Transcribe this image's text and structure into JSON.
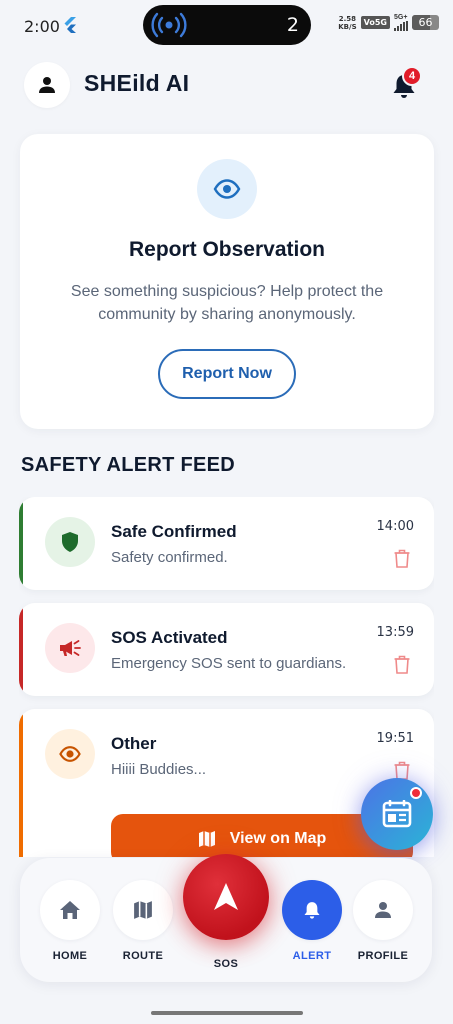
{
  "status_bar": {
    "time": "2:00",
    "live_count": "2",
    "speed_value": "2.58",
    "speed_unit": "KB/S",
    "volte": "Vo5G",
    "network": "5G+",
    "battery": "66"
  },
  "header": {
    "title": "SHEild AI",
    "notification_count": "4"
  },
  "report_card": {
    "title": "Report Observation",
    "description": "See something suspicious? Help protect the community by sharing anonymously.",
    "button_label": "Report Now"
  },
  "feed": {
    "section_title": "SAFETY ALERT FEED",
    "items": [
      {
        "title": "Safe Confirmed",
        "message": "Safety confirmed.",
        "time": "14:00",
        "accent": "#2e7d32",
        "icon": "shield-icon"
      },
      {
        "title": "SOS Activated",
        "message": "Emergency SOS sent to guardians.",
        "time": "13:59",
        "accent": "#c62828",
        "icon": "megaphone-icon"
      },
      {
        "title": "Other",
        "message": "Hiiii Buddies...",
        "time": "19:51",
        "accent": "#ef6c00",
        "icon": "eye-icon",
        "action_label": "View on Map"
      }
    ]
  },
  "nav": {
    "home": "HOME",
    "route": "ROUTE",
    "sos": "SOS",
    "alert": "ALERT",
    "profile": "PROFILE",
    "active": "ALERT"
  },
  "colors": {
    "primary_blue": "#2c5ee8",
    "sos_red": "#c1121c",
    "map_button": "#e5540d"
  }
}
